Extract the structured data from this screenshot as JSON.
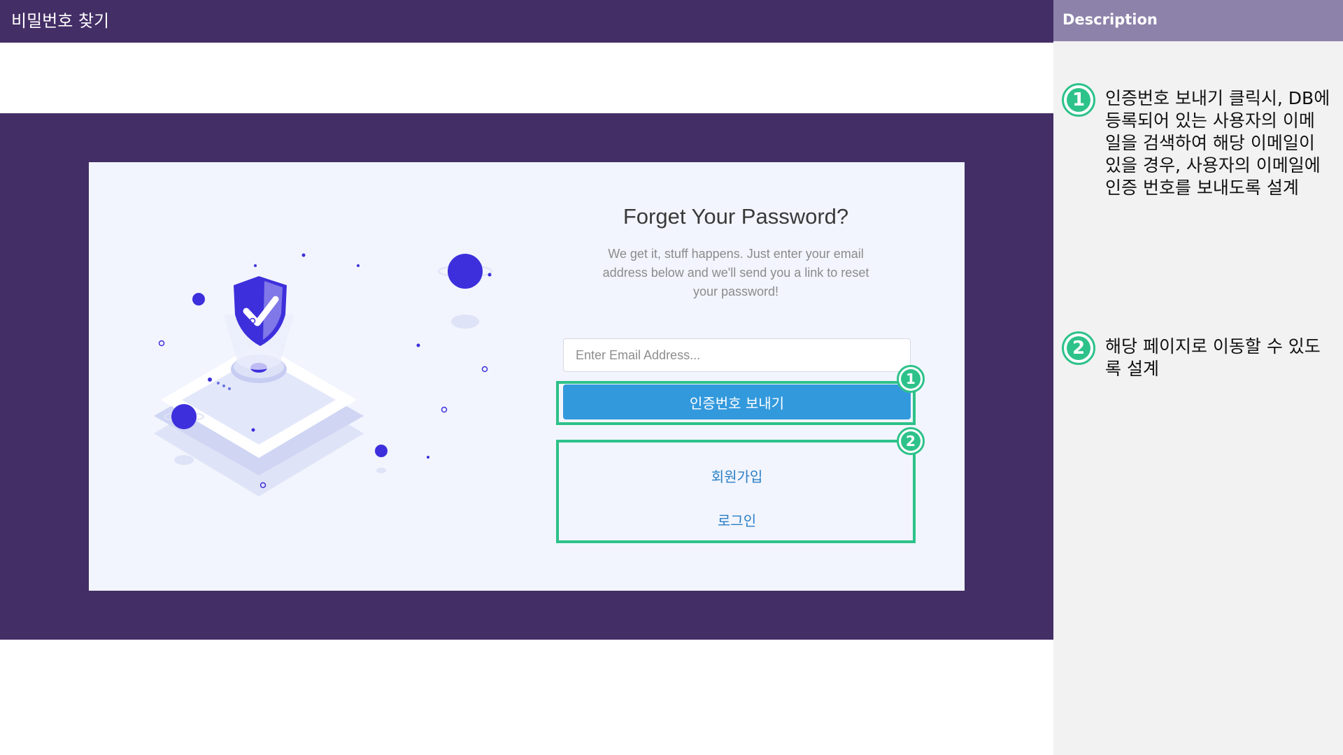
{
  "header": {
    "title": "비밀번호 찾기"
  },
  "description": {
    "title": "Description",
    "items": [
      {
        "number": "1",
        "text": "인증번호 보내기 클릭시, DB에 등록되어 있는 사용자의 이메일을 검색하여 해당 이메일이 있을 경우, 사용자의 이메일에 인증 번호를 보내도록 설계"
      },
      {
        "number": "2",
        "text": "해당 페이지로 이동할 수 있도록 설계"
      }
    ]
  },
  "form": {
    "title": "Forget Your Password?",
    "subtitle": "We get it, stuff happens. Just enter your email address below and we'll send you a link to reset your password!",
    "email_placeholder": "Enter Email Address...",
    "send_button": "인증번호 보내기",
    "signup_link": "회원가입",
    "login_link": "로그인"
  },
  "annotations": {
    "marker_1": "1",
    "marker_2": "2"
  },
  "colors": {
    "header_bg": "#432e66",
    "desc_header_bg": "#8d82aa",
    "card_bg": "#f2f5fd",
    "button_bg": "#3399dd",
    "highlight": "#2dc28a",
    "illustration_accent": "#3d2fdc"
  }
}
